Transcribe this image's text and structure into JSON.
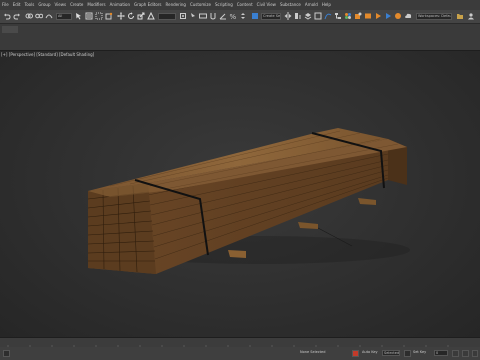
{
  "menu": [
    "File",
    "Edit",
    "Tools",
    "Group",
    "Views",
    "Create",
    "Modifiers",
    "Animation",
    "Graph Editors",
    "Rendering",
    "Customize",
    "Scripting",
    "Content",
    "Civil View",
    "Substance",
    "Arnold",
    "Help"
  ],
  "toolbar": {
    "selection_filter": "All",
    "named_selection_set": "Create Selection Set",
    "workspace": "Workspaces: Default"
  },
  "viewport": {
    "label_parts": [
      "[+]",
      "[Perspective]",
      "[Standard]",
      "[Default Shading]"
    ]
  },
  "timeline": {
    "ticks": [
      "0",
      "5",
      "10",
      "15",
      "20",
      "25",
      "30",
      "35",
      "40",
      "45",
      "50",
      "55",
      "60",
      "65",
      "70",
      "75",
      "80",
      "85",
      "90",
      "95",
      "100"
    ]
  },
  "status": {
    "prompt": "",
    "selected": "None Selected",
    "autokey": "Auto Key",
    "setkey": "Set Key",
    "key_filter": "Selected",
    "frame": "0"
  },
  "colors": {
    "wood_top": "#8a6237",
    "wood_front": "#6e4a26",
    "wood_side": "#4e331a",
    "band": "#111111",
    "accent_orange": "#e38a2c",
    "accent_blue": "#3a7fd0"
  }
}
